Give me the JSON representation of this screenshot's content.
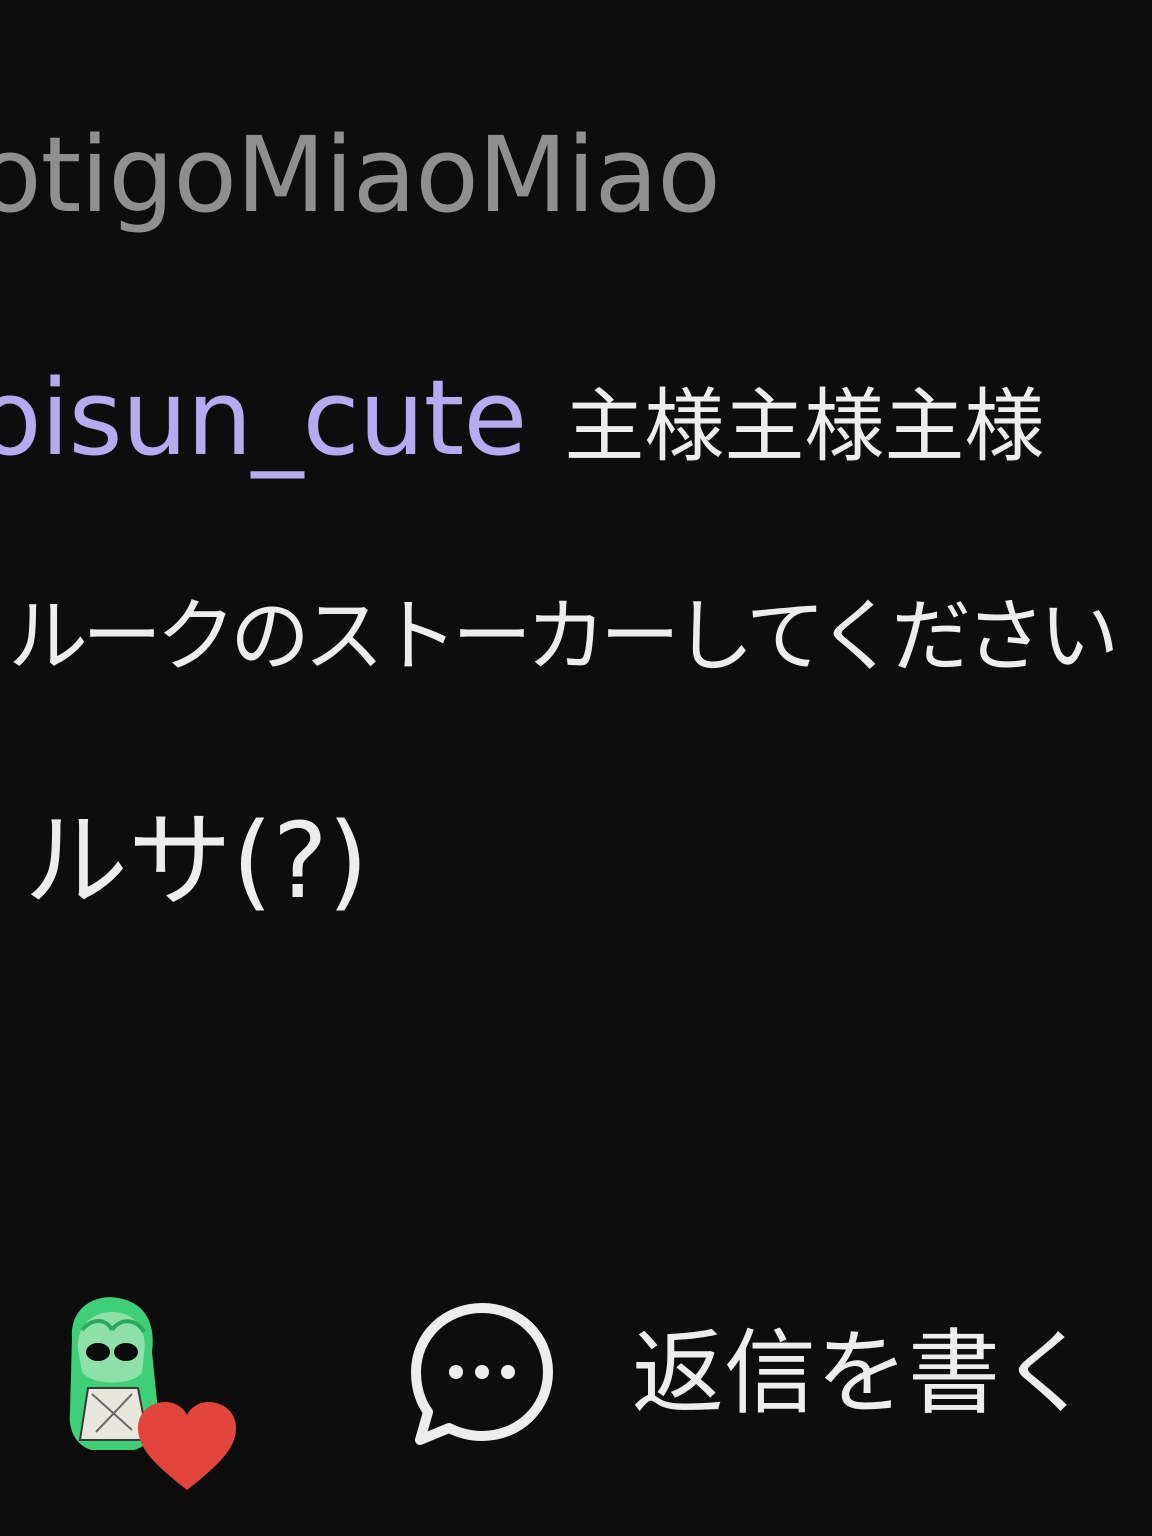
{
  "previous_comment": {
    "username": "otigoMiaoMiao"
  },
  "comment": {
    "username": "oisun_cute",
    "text_line_1": "主様主様主様",
    "text_line_2": "ルークのストーカーしてください",
    "text_line_3": "ルサ(?)"
  },
  "footer": {
    "liker_avatar": "liker-avatar",
    "heart_icon": "heart-icon",
    "heart_color": "#e2453c",
    "reply_icon": "chat-bubble-icon",
    "reply_label": "返信を書く"
  },
  "colors": {
    "background": "#0d0d0d",
    "username_muted": "#8f8f8f",
    "username_accent": "#b6aaf0",
    "text": "#ededed"
  }
}
